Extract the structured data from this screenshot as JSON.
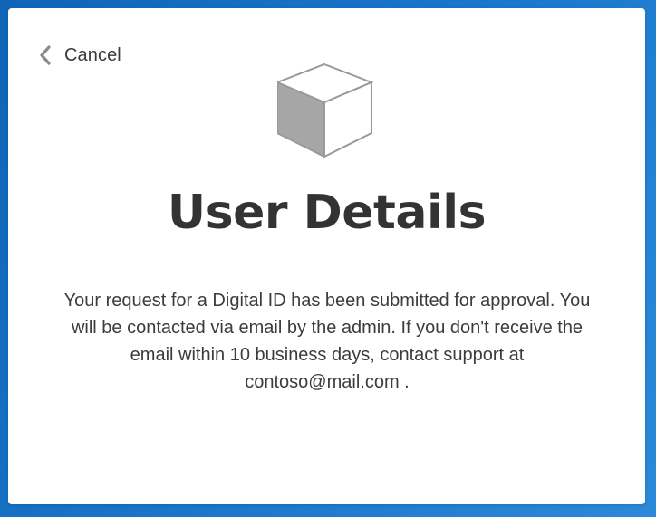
{
  "dialog": {
    "cancel_label": "Cancel",
    "title": "User Details",
    "message": "Your request for a Digital ID has been submitted for approval. You will be contacted via email by the admin. If you don't receive the email within 10 business days, contact support at contoso@mail.com ."
  },
  "icons": {
    "back": "chevron-left-icon",
    "illustration": "cube-icon"
  },
  "colors": {
    "background": "#1a72c4",
    "card": "#ffffff",
    "text": "#333333",
    "icon": "#8a8a8a"
  }
}
